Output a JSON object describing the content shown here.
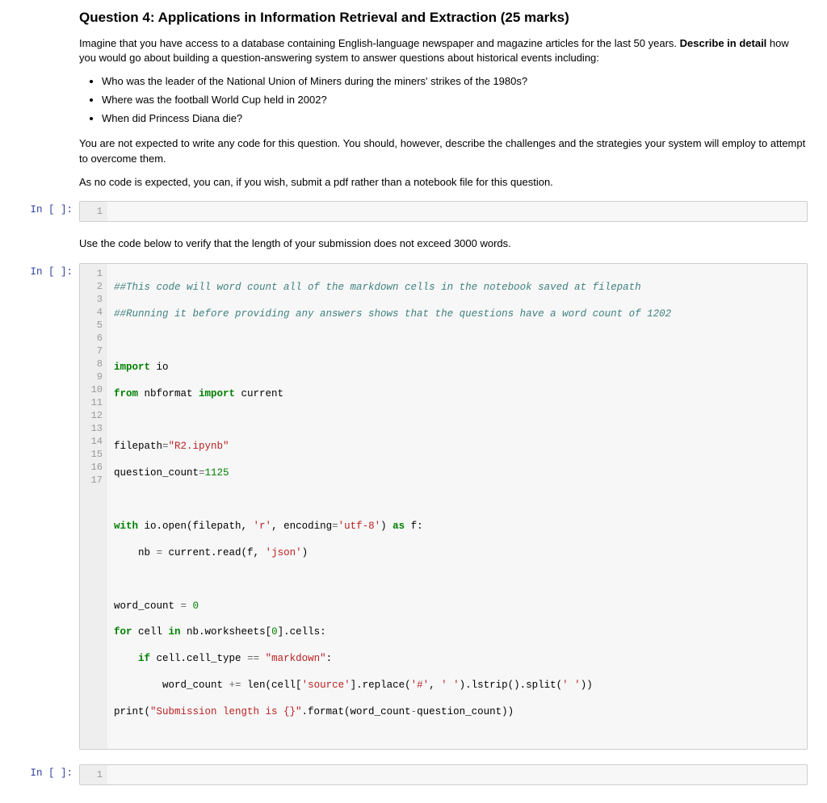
{
  "markdown1": {
    "heading": "Question 4: Applications in Information Retrieval and Extraction (25 marks)",
    "intro_a": "Imagine that you have access to a database containing English-language newspaper and magazine articles for the last 50 years. ",
    "intro_bold": "Describe in detail",
    "intro_b": " how you would go about building a question-answering system to answer questions about historical events including:",
    "bullets": [
      "Who was the leader of the National Union of Miners during the miners' strikes of the 1980s?",
      "Where was the football World Cup held in 2002?",
      "When did Princess Diana die?"
    ],
    "para2": "You are not expected to write any code for this question. You should, however, describe the challenges and the strategies your system will employ to attempt to overcome them.",
    "para3": "As no code is expected, you can, if you wish, submit a pdf rather than a notebook file for this question."
  },
  "prompt_label": "In [ ]:",
  "empty_line_no": "1",
  "markdown2": {
    "para": "Use the code below to verify that the length of your submission does not exceed 3000 words."
  },
  "code": {
    "line_numbers": [
      "1",
      "2",
      "3",
      "4",
      "5",
      "6",
      "7",
      "8",
      "9",
      "10",
      "11",
      "12",
      "13",
      "14",
      "15",
      "16",
      "17"
    ],
    "c1": "##This code will word count all of the markdown cells in the notebook saved at filepath",
    "c2": "##Running it before providing any answers shows that the questions have a word count of 1202",
    "l4": {
      "kw1": "import",
      "t1": " io"
    },
    "l5": {
      "kw1": "from",
      "t1": " nbformat ",
      "kw2": "import",
      "t2": " current"
    },
    "l7": {
      "t1": "filepath",
      "op": "=",
      "str": "\"R2.ipynb\""
    },
    "l8": {
      "t1": "question_count",
      "op": "=",
      "num": "1125"
    },
    "l10": {
      "kw1": "with",
      "t1": " io.open(filepath, ",
      "str1": "'r'",
      "t2": ", encoding",
      "op": "=",
      "str2": "'utf-8'",
      "t3": ") ",
      "kw2": "as",
      "t4": " f:"
    },
    "l11": {
      "t1": "    nb ",
      "op": "=",
      "t2": " current.read(f, ",
      "str1": "'json'",
      "t3": ")"
    },
    "l13": {
      "t1": "word_count ",
      "op": "=",
      "t2": " ",
      "num": "0"
    },
    "l14": {
      "kw1": "for",
      "t1": " cell ",
      "kw2": "in",
      "t2": " nb.worksheets[",
      "num": "0",
      "t3": "].cells:"
    },
    "l15": {
      "t1": "    ",
      "kw1": "if",
      "t2": " cell.cell_type ",
      "op": "==",
      "t3": " ",
      "str1": "\"markdown\"",
      "t4": ":"
    },
    "l16": {
      "t1": "        word_count ",
      "op1": "+=",
      "t2": " len(cell[",
      "str1": "'source'",
      "t3": "].replace(",
      "str2": "'#'",
      "t4": ", ",
      "str3": "' '",
      "t5": ").lstrip().split(",
      "str4": "' '",
      "t6": "))"
    },
    "l17": {
      "t1": "print(",
      "str1": "\"Submission length is {}\"",
      "t2": ".format(word_count",
      "op": "-",
      "t3": "question_count))"
    }
  }
}
